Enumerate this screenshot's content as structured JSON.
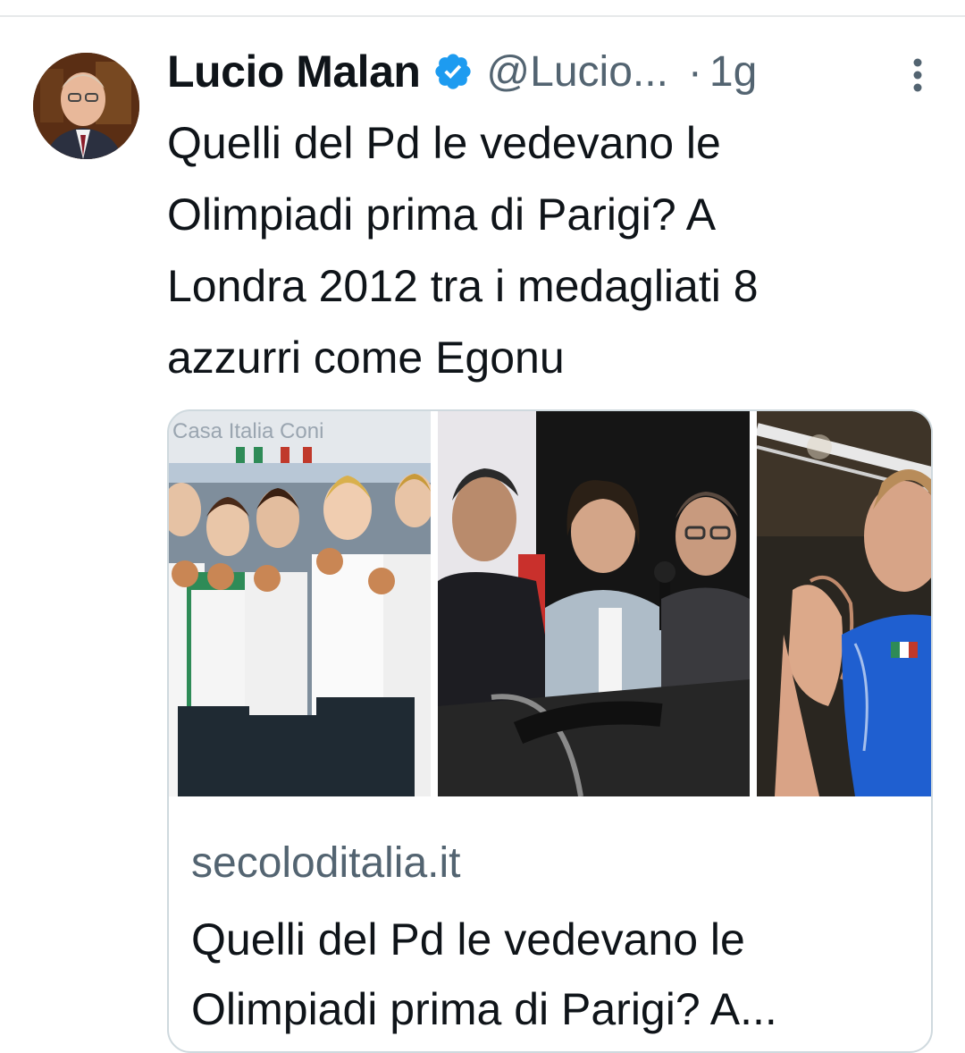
{
  "tweet": {
    "author": {
      "display_name": "Lucio Malan",
      "handle": "@Lucio...",
      "verified_icon": "verified-badge-icon",
      "avatar": "avatar-photo"
    },
    "separator": "·",
    "time": "1g",
    "more_icon": "more-options-icon",
    "text": "Quelli del Pd le vedevano le\nOlimpiadi prima di Parigi? A\nLondra 2012 tra i medagliati 8\nazzurri come Egonu",
    "card": {
      "images": [
        "photo-synchronized-swimmers-medals",
        "photo-panel-speakers",
        "photo-volleyball-player"
      ],
      "banner_text": "Casa Italia Coni",
      "domain": "secoloditalia.it",
      "title": "Quelli del Pd le vedevano le\nOlimpiadi prima di Parigi? A..."
    }
  },
  "colors": {
    "text_primary": "#0f1419",
    "text_secondary": "#536471",
    "verified_blue": "#1d9bf0",
    "border": "#cfd9de"
  }
}
